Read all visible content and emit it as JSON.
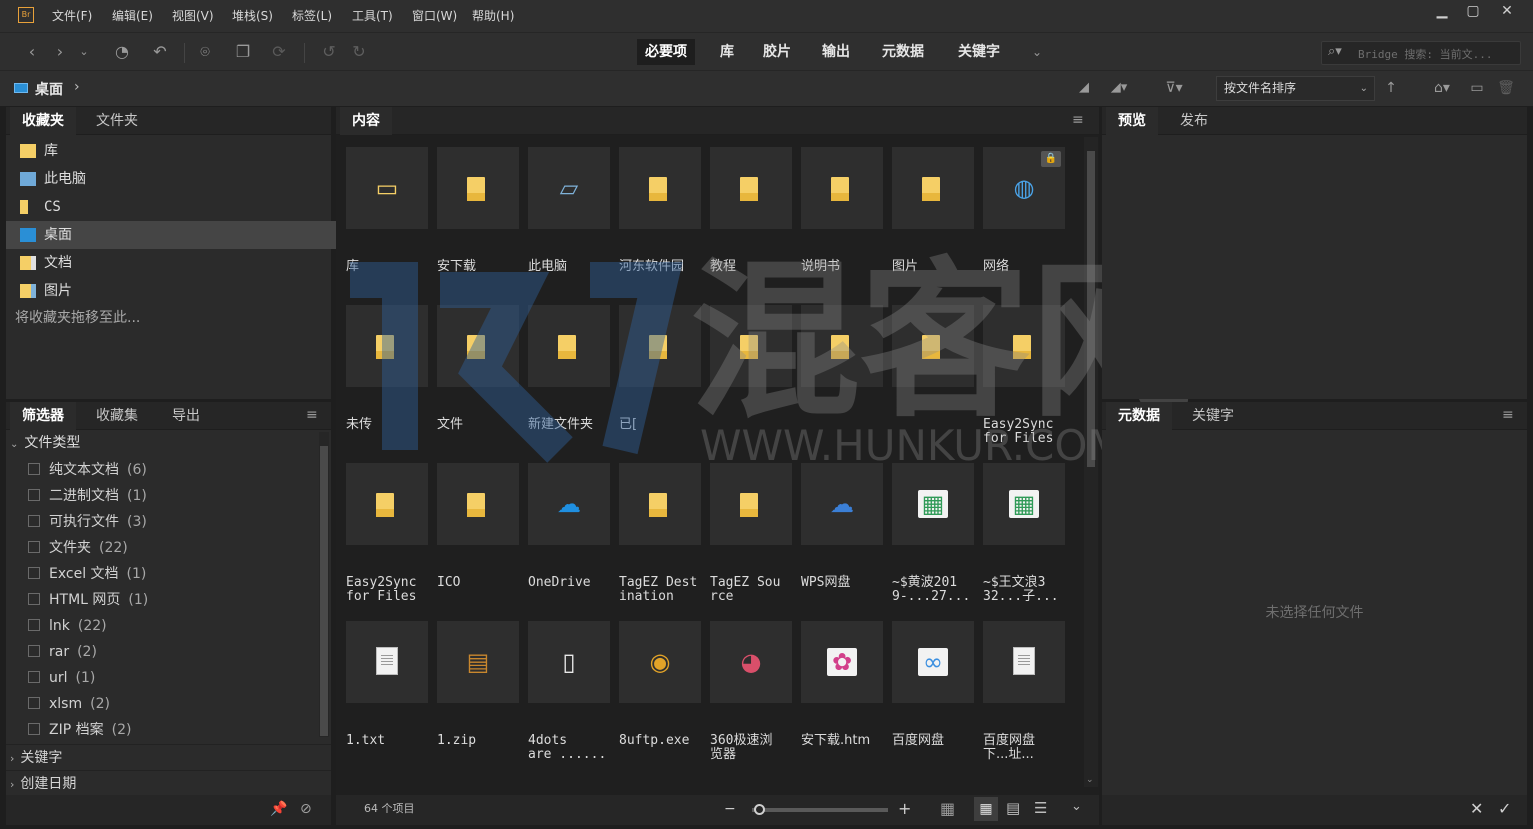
{
  "app": {
    "logo_text": "Br"
  },
  "menu": [
    "文件(F)",
    "编辑(E)",
    "视图(V)",
    "堆栈(S)",
    "标签(L)",
    "工具(T)",
    "窗口(W)",
    "帮助(H)"
  ],
  "window_controls": {
    "minimize": "▁",
    "maximize": "▢",
    "close": "✕"
  },
  "workspaces": [
    {
      "label": "必要项",
      "active": true
    },
    {
      "label": "库",
      "active": false
    },
    {
      "label": "胶片",
      "active": false
    },
    {
      "label": "输出",
      "active": false
    },
    {
      "label": "元数据",
      "active": false
    },
    {
      "label": "关键字",
      "active": false
    }
  ],
  "search": {
    "placeholder": "Bridge 搜索: 当前文..."
  },
  "path": {
    "current": "桌面",
    "separator": "›"
  },
  "sort": {
    "label": "按文件名排序"
  },
  "left_top_panel": {
    "tabs": [
      "收藏夹",
      "文件夹"
    ],
    "items": [
      {
        "label": "库",
        "icon": "library-folder-icon"
      },
      {
        "label": "此电脑",
        "icon": "computer-icon"
      },
      {
        "label": "CS",
        "icon": "folder-icon"
      },
      {
        "label": "桌面",
        "icon": "desktop-icon",
        "selected": true
      },
      {
        "label": "文档",
        "icon": "documents-icon"
      },
      {
        "label": "图片",
        "icon": "pictures-icon"
      }
    ],
    "drop_hint": "将收藏夹拖移至此..."
  },
  "filter_panel": {
    "tabs": [
      "筛选器",
      "收藏集",
      "导出"
    ],
    "section_file_type": "文件类型",
    "file_types": [
      {
        "label": "纯文本文档",
        "count": "(6)"
      },
      {
        "label": "二进制文档",
        "count": "(1)"
      },
      {
        "label": "可执行文件",
        "count": "(3)"
      },
      {
        "label": "文件夹",
        "count": "(22)"
      },
      {
        "label": "Excel 文档",
        "count": "(1)"
      },
      {
        "label": "HTML 网页",
        "count": "(1)"
      },
      {
        "label": "lnk",
        "count": "(22)"
      },
      {
        "label": "rar",
        "count": "(2)"
      },
      {
        "label": "url",
        "count": "(1)"
      },
      {
        "label": "xlsm",
        "count": "(2)"
      },
      {
        "label": "ZIP 档案",
        "count": "(2)"
      }
    ],
    "section_keywords": "关键字",
    "section_date": "创建日期"
  },
  "content_panel": {
    "tab": "内容",
    "items": [
      {
        "label": "库",
        "kind": "library"
      },
      {
        "label": "安下载",
        "kind": "folder"
      },
      {
        "label": "此电脑",
        "kind": "computer"
      },
      {
        "label": "河东软件园",
        "kind": "folder"
      },
      {
        "label": "教程",
        "kind": "folder"
      },
      {
        "label": "说明书",
        "kind": "folder"
      },
      {
        "label": "图片",
        "kind": "folder"
      },
      {
        "label": "网络",
        "kind": "network",
        "locked": true
      },
      {
        "label": "未传",
        "kind": "folder"
      },
      {
        "label": "文件",
        "kind": "folder"
      },
      {
        "label": "新建文件夹",
        "kind": "folder"
      },
      {
        "label": "已[",
        "kind": "folder"
      },
      {
        "label": "",
        "kind": "folder"
      },
      {
        "label": "",
        "kind": "folder"
      },
      {
        "label": "",
        "kind": "folder"
      },
      {
        "label": "Easy2Sync\nfor Files",
        "kind": "folder"
      },
      {
        "label": "Easy2Sync\nfor Files",
        "kind": "folder"
      },
      {
        "label": "ICO",
        "kind": "folder"
      },
      {
        "label": "OneDrive",
        "kind": "onedrive"
      },
      {
        "label": "TagEZ Dest\nination",
        "kind": "folder"
      },
      {
        "label": "TagEZ Sou\nrce",
        "kind": "folder"
      },
      {
        "label": "WPS网盘",
        "kind": "cloud"
      },
      {
        "label": "~$黄波201\n9-...27...",
        "kind": "excel"
      },
      {
        "label": "~$王文浪3\n32...子...",
        "kind": "excel"
      },
      {
        "label": "1.txt",
        "kind": "text"
      },
      {
        "label": "1.zip",
        "kind": "zip"
      },
      {
        "label": "4dots\nare ......",
        "kind": "shortcut"
      },
      {
        "label": "8uftp.exe",
        "kind": "ftp"
      },
      {
        "label": "360极速浏\n览器",
        "kind": "browser"
      },
      {
        "label": "安下载.htm",
        "kind": "html"
      },
      {
        "label": "百度网盘",
        "kind": "baidu"
      },
      {
        "label": "百度网盘\n下...址...",
        "kind": "text"
      }
    ],
    "status": "64 个项目"
  },
  "preview_panel": {
    "tabs": [
      "预览",
      "发布"
    ]
  },
  "metadata_panel": {
    "tabs": [
      "元数据",
      "关键字"
    ],
    "empty_text": "未选择任何文件"
  },
  "watermark": {
    "text": "混客网",
    "url": "WWW.HUNKUR.COM"
  },
  "colors": {
    "folder": "#f5cf66",
    "accent": "#e8a13a",
    "onedrive": "#1f8fe0",
    "selection": "#454545"
  }
}
